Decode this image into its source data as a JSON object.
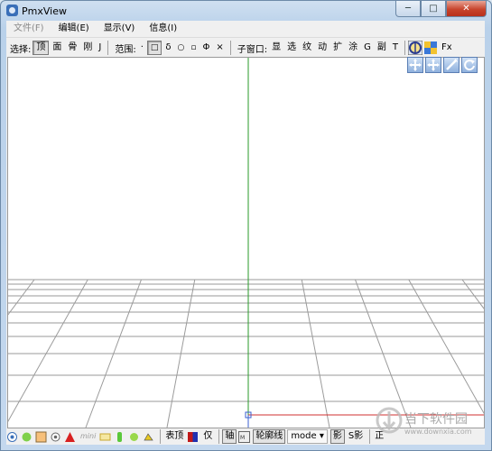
{
  "window": {
    "title": "PmxView",
    "controls": {
      "minimize": "─",
      "maximize": "□",
      "close": "✕"
    }
  },
  "menu": {
    "items": [
      "文件(F)",
      "编辑(E)",
      "显示(V)",
      "信息(I)"
    ]
  },
  "toolbar": {
    "select_label": "选择:",
    "select_items": [
      "顶",
      "面",
      "骨",
      "刚",
      "J"
    ],
    "range_label": "范围:",
    "range_items": [
      "·",
      "□",
      "δ",
      "○",
      "▫",
      "Φ",
      "×"
    ],
    "subwindow_label": "子窗口:",
    "subwindow_items": [
      "显",
      "选",
      "纹",
      "动",
      "扩",
      "涂",
      "G",
      "副",
      "T"
    ],
    "fx_label": "Fx"
  },
  "statusbar": {
    "mini_label": "mini",
    "table_top": "表顶",
    "only": "仅",
    "axis": "轴",
    "outline": "轮廓线",
    "mode": "mode ▾",
    "shadow": "影",
    "s_shadow": "S影",
    "correct": "正"
  },
  "watermark": {
    "text": "当下软件园",
    "url": "www.downxia.com"
  },
  "colors": {
    "y_axis": "#2a9a2a",
    "x_axis": "#d23030",
    "z_axis": "#3a5fd0",
    "grid": "#9a9a9a",
    "close_button": "#c7442d"
  }
}
